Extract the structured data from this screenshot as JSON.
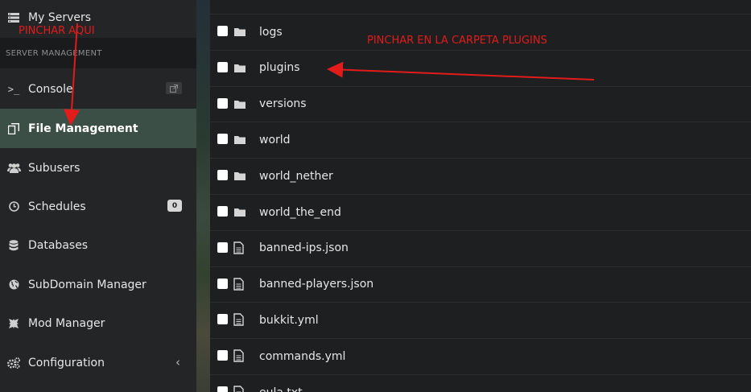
{
  "sidebar": {
    "my_servers": "My Servers",
    "section_header": "SERVER MANAGEMENT",
    "items": [
      {
        "label": "Console"
      },
      {
        "label": "File Management"
      },
      {
        "label": "Subusers"
      },
      {
        "label": "Schedules",
        "badge": "0"
      },
      {
        "label": "Databases"
      },
      {
        "label": "SubDomain Manager"
      },
      {
        "label": "Mod Manager"
      },
      {
        "label": "Configuration"
      }
    ]
  },
  "files": [
    {
      "name": "logs",
      "type": "folder"
    },
    {
      "name": "plugins",
      "type": "folder"
    },
    {
      "name": "versions",
      "type": "folder"
    },
    {
      "name": "world",
      "type": "folder"
    },
    {
      "name": "world_nether",
      "type": "folder"
    },
    {
      "name": "world_the_end",
      "type": "folder"
    },
    {
      "name": "banned-ips.json",
      "type": "file"
    },
    {
      "name": "banned-players.json",
      "type": "file"
    },
    {
      "name": "bukkit.yml",
      "type": "file"
    },
    {
      "name": "commands.yml",
      "type": "file"
    },
    {
      "name": "eula.txt",
      "type": "file"
    }
  ],
  "annotations": {
    "left_note": "PINCHAR AQUI",
    "right_note": "PINCHAR EN LA CARPETA PLUGINS",
    "color": "#e21b1b"
  },
  "colors": {
    "sidebar_bg": "#242526",
    "active_item_bg": "#3c4f47",
    "content_bg": "#1e1f20"
  }
}
